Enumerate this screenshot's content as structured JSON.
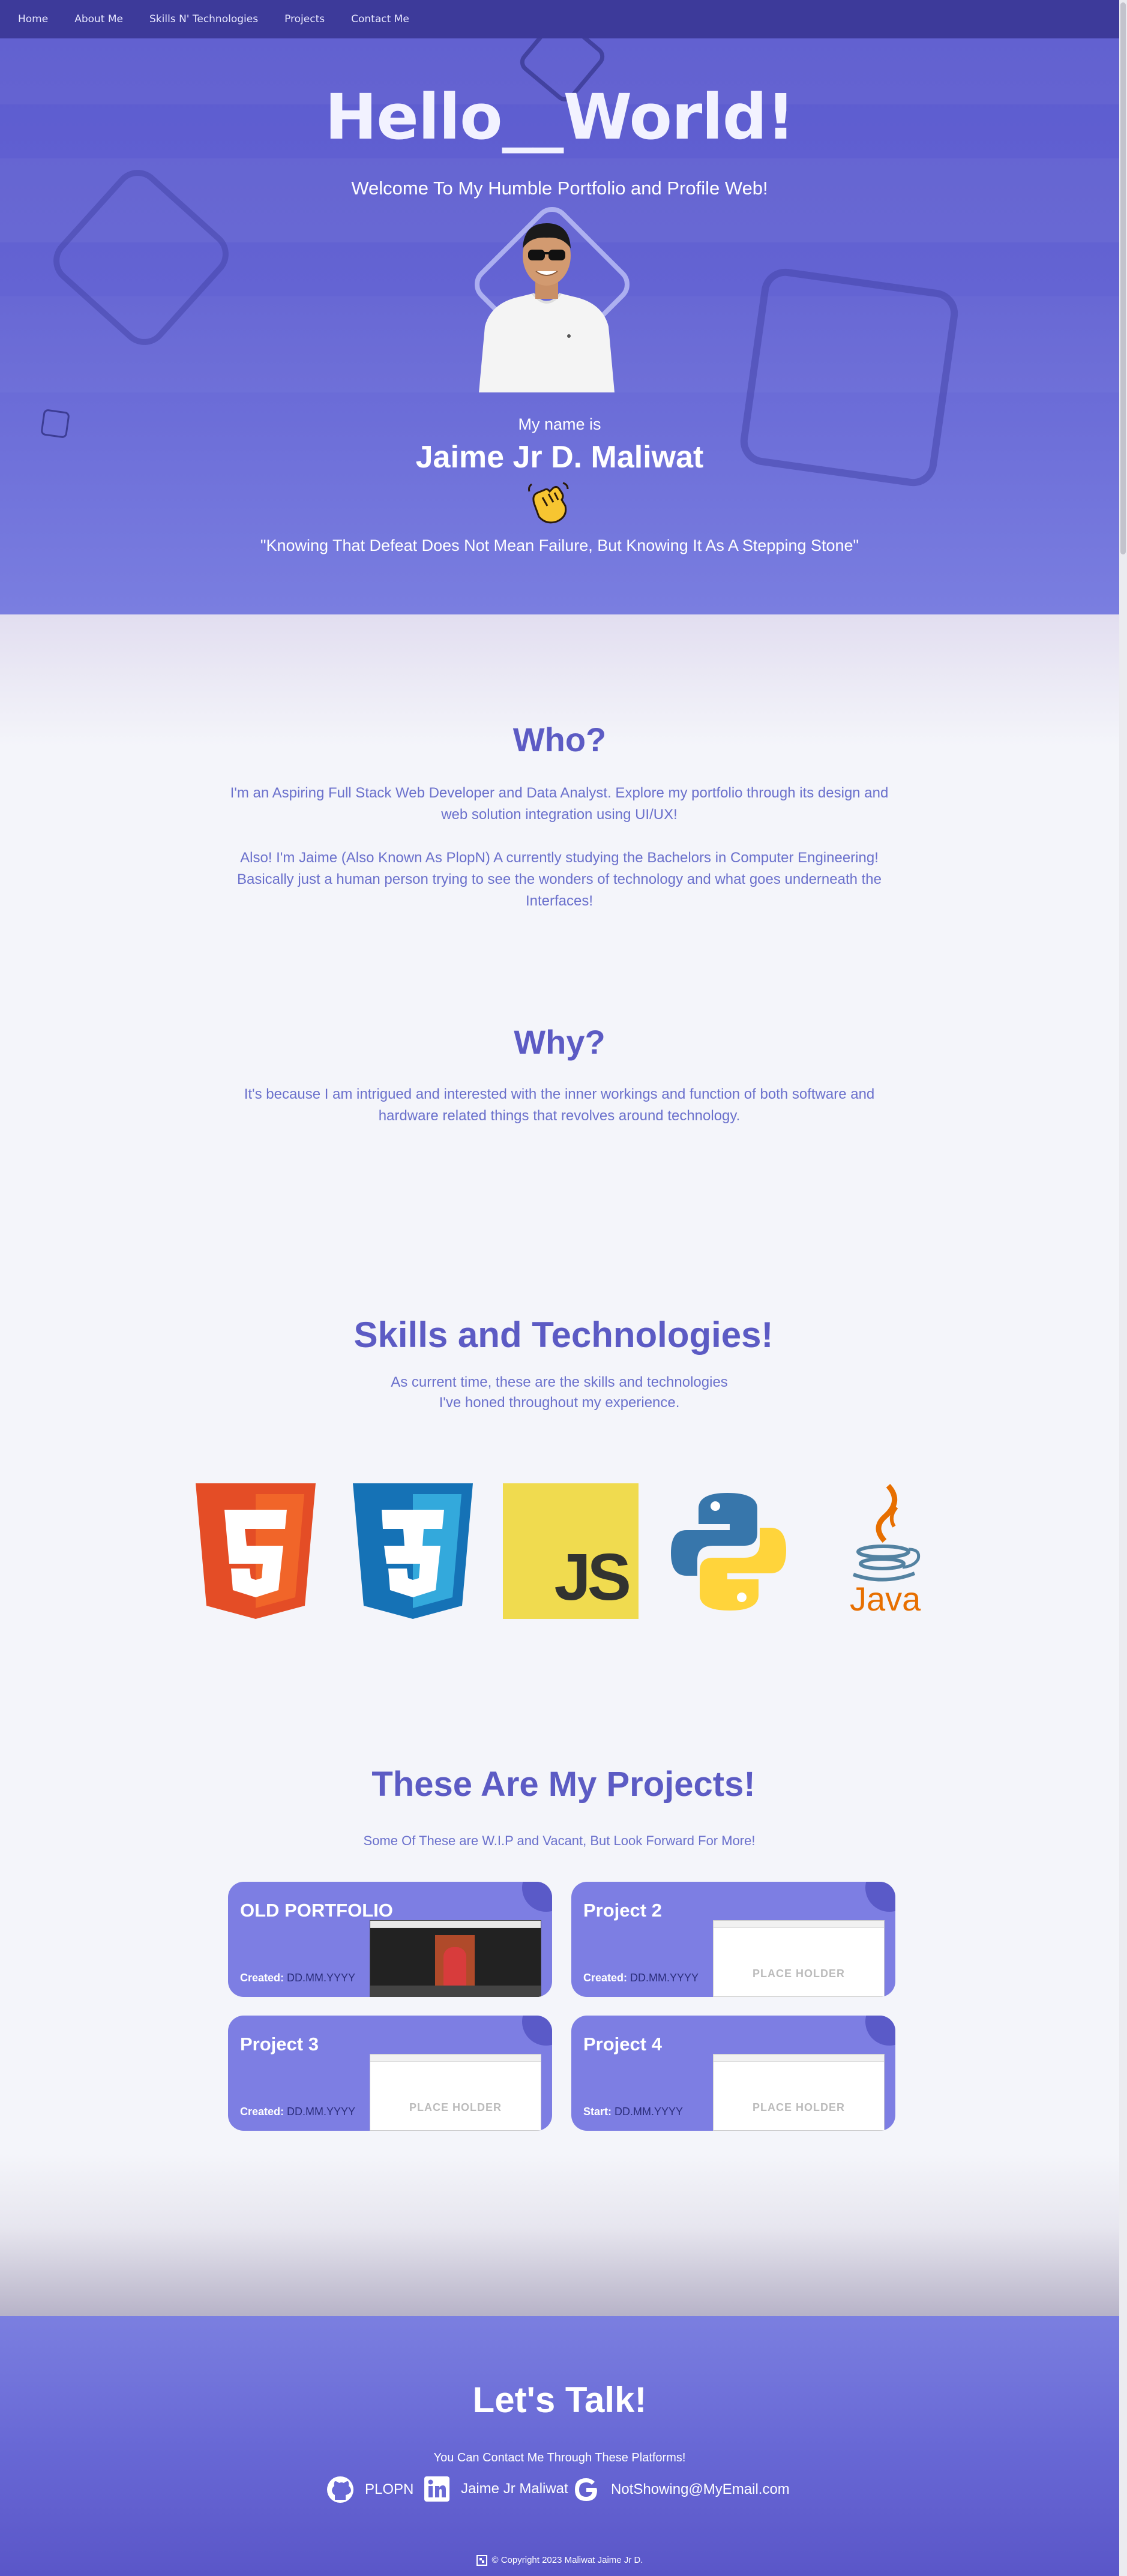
{
  "nav": {
    "items": [
      "Home",
      "About Me",
      "Skills N' Technologies",
      "Projects",
      "Contact Me"
    ]
  },
  "hero": {
    "title": "Hello__World!",
    "subtitle": "Welcome To My Humble Portfolio and Profile Web!",
    "name_label": "My name is",
    "name": "Jaime Jr D. Maliwat",
    "wave_icon": "waving-hand-icon",
    "quote": "\"Knowing That Defeat Does Not Mean Failure, But Knowing It As A Stepping Stone\""
  },
  "about": {
    "who_title": "Who?",
    "who_p1": "I'm an Aspiring Full Stack Web Developer and Data Analyst. Explore my portfolio through its design and web solution integration using UI/UX!",
    "who_p2": "Also! I'm Jaime (Also Known As PlopN) A currently studying the Bachelors in Computer Engineering! Basically just a human person trying to see the wonders of technology and what goes underneath the Interfaces!",
    "why_title": "Why?",
    "why_p": "It's because I am intrigued and interested with the inner workings and function of both software and hardware related things that revolves around technology."
  },
  "skills": {
    "title": "Skills and Technologies!",
    "subtitle_line1": "As current time, these are the skills and technologies",
    "subtitle_line2": "I've honed throughout my experience.",
    "logos": [
      "html5-logo",
      "css3-logo",
      "javascript-logo",
      "python-logo",
      "java-logo"
    ],
    "js_text": "JS",
    "java_text": "Java"
  },
  "projects": {
    "title": "These Are My Projects!",
    "subtitle": "Some Of These are W.I.P and Vacant, But Look Forward For More!",
    "placeholder_text": "PLACE HOLDER",
    "cards": [
      {
        "title": "OLD PORTFOLIO",
        "meta_label": "Created:",
        "meta_value": "DD.MM.YYYY"
      },
      {
        "title": "Project 2",
        "meta_label": "Created:",
        "meta_value": "DD.MM.YYYY"
      },
      {
        "title": "Project 3",
        "meta_label": "Created:",
        "meta_value": "DD.MM.YYYY"
      },
      {
        "title": "Project 4",
        "meta_label": "Start:",
        "meta_value": "DD.MM.YYYY"
      }
    ]
  },
  "contact": {
    "title": "Let's Talk!",
    "subtitle": "You Can Contact Me Through These Platforms!",
    "github": "PLOPN",
    "linkedin": "Jaime Jr Maliwat",
    "email": "NotShowing@MyEmail.com",
    "copyright": "© Copyright 2023 Maliwat Jaime Jr D."
  },
  "colors": {
    "nav_bg": "#3d3a9a",
    "hero_top": "#5c5bcf",
    "accent": "#5c5bc4",
    "card_bg": "#7d7ee3"
  }
}
